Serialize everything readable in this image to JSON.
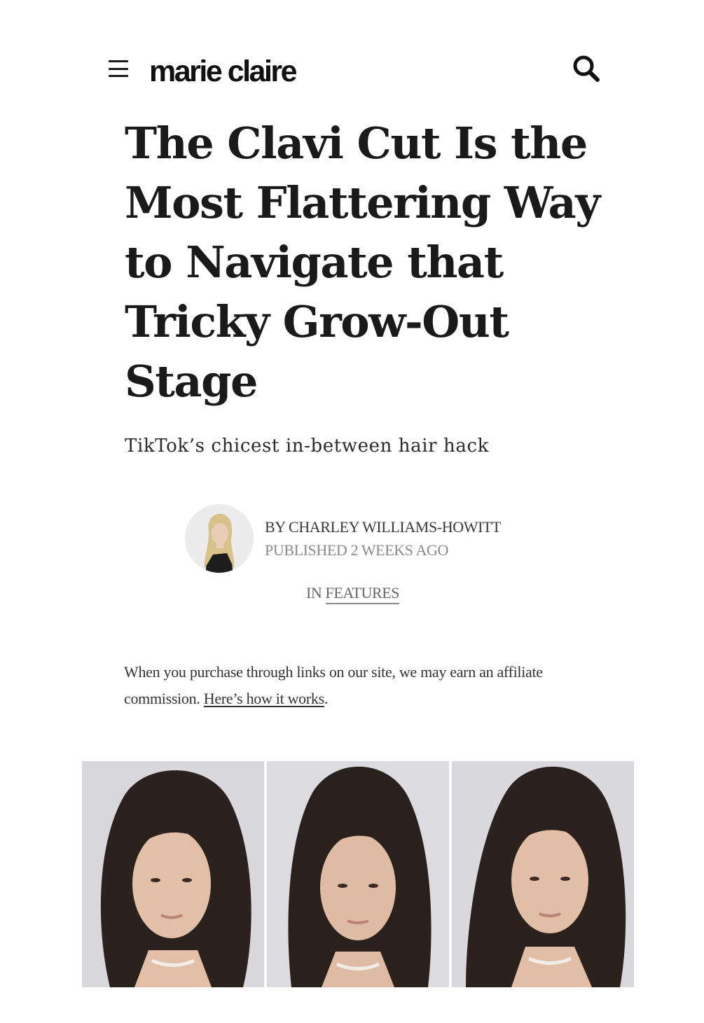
{
  "header": {
    "logo": "marie claire",
    "menu_icon": "hamburger-menu-icon",
    "search_icon": "search-icon"
  },
  "article": {
    "title": "The Clavi Cut Is the Most Flattering Way to Navigate that Tricky Grow-Out Stage",
    "title_lines": [
      "The Clavi Cut Is the",
      "Most Flattering Way",
      "to Navigate that",
      "Tricky Grow-Out",
      "Stage"
    ],
    "subtitle": "TikTok’s chicest in-between hair hack",
    "byline": {
      "author": "BY CHARLEY WILLIAMS-HOWITT",
      "published": "PUBLISHED 2 WEEKS AGO",
      "category_prefix": "IN",
      "category": "FEATURES"
    },
    "disclosure": {
      "text": "When you purchase through links on our site, we may earn an affiliate commission.",
      "link": "Here’s how it works",
      "suffix": "."
    }
  },
  "colors": {
    "text": "#1a1a1a",
    "muted": "#8a8a8a",
    "photo_bg": "#d9d8dc",
    "hair": "#2b211d",
    "skin": "#e3bfa8"
  }
}
